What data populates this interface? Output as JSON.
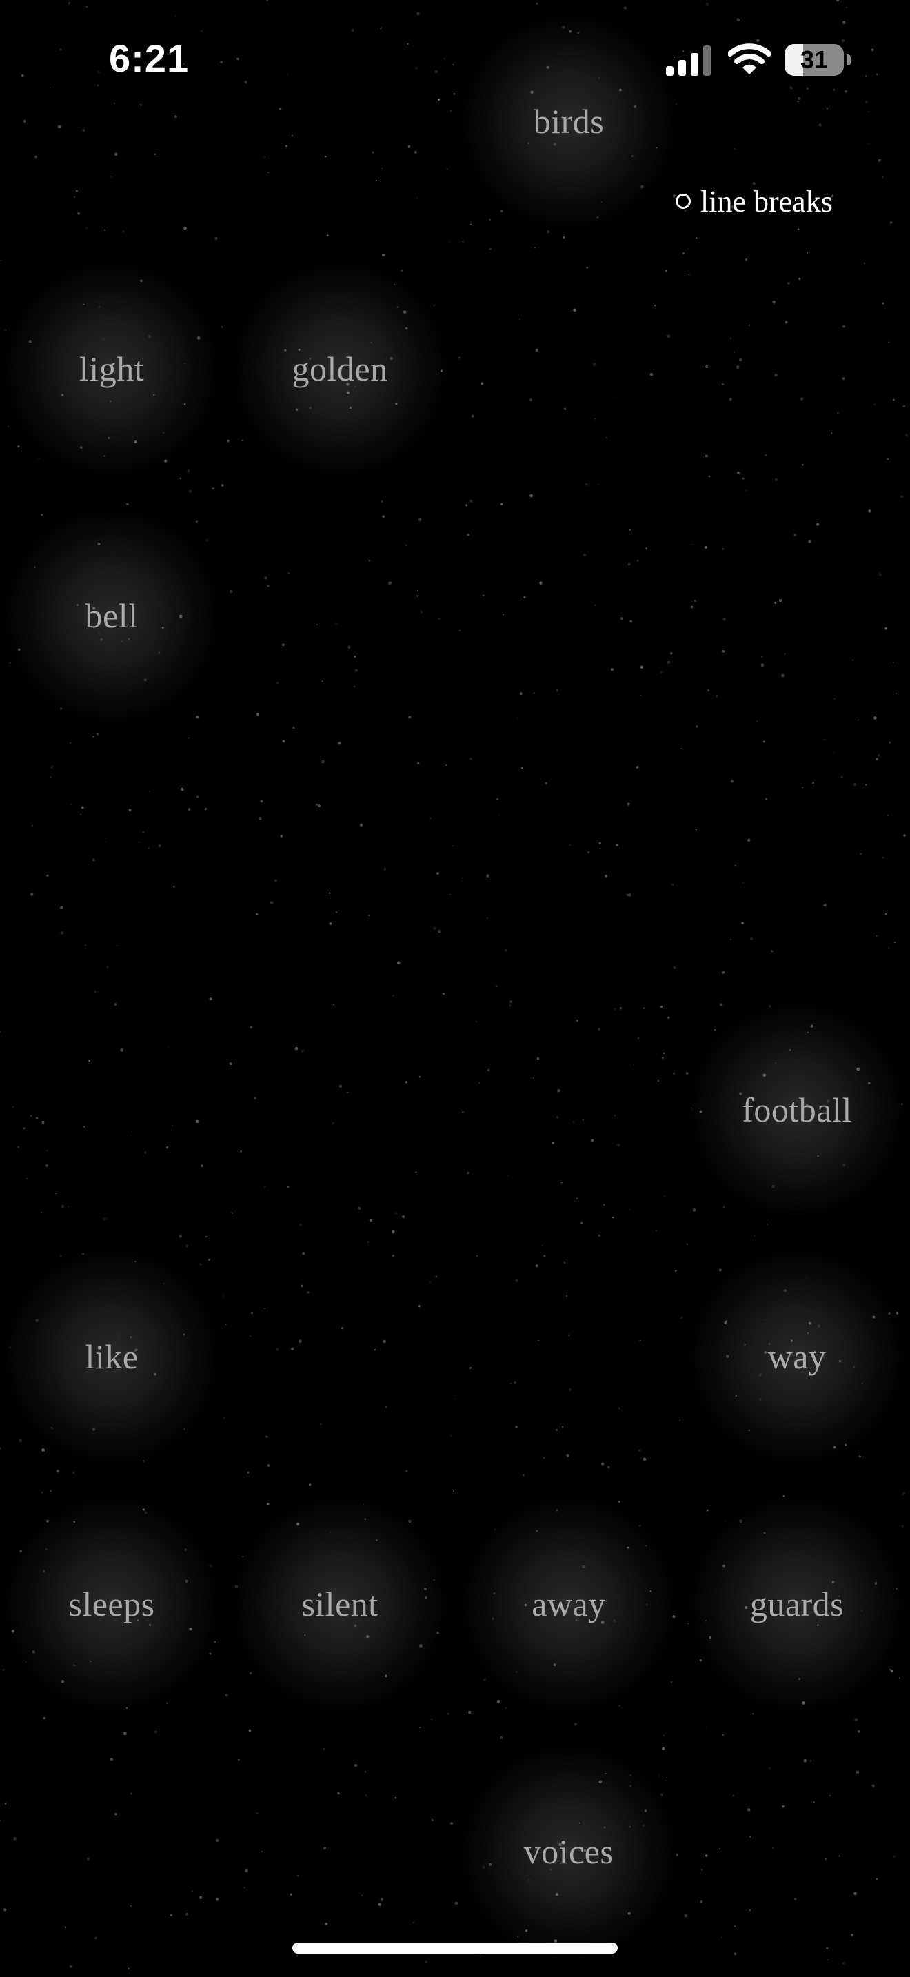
{
  "status_bar": {
    "time": "6:21",
    "battery_level": "31",
    "battery_fraction": 0.31,
    "signal_icon": "cellular-signal-icon",
    "wifi_icon": "wifi-icon"
  },
  "toggle": {
    "label": "line breaks",
    "checked": false
  },
  "words": [
    "birds",
    "light",
    "golden",
    "bell",
    "football",
    "like",
    "way",
    "sleeps",
    "silent",
    "away",
    "guards",
    "voices"
  ],
  "colors": {
    "background": "#000000",
    "word_text": "#a9a9a9",
    "ui_text": "#ffffff"
  }
}
